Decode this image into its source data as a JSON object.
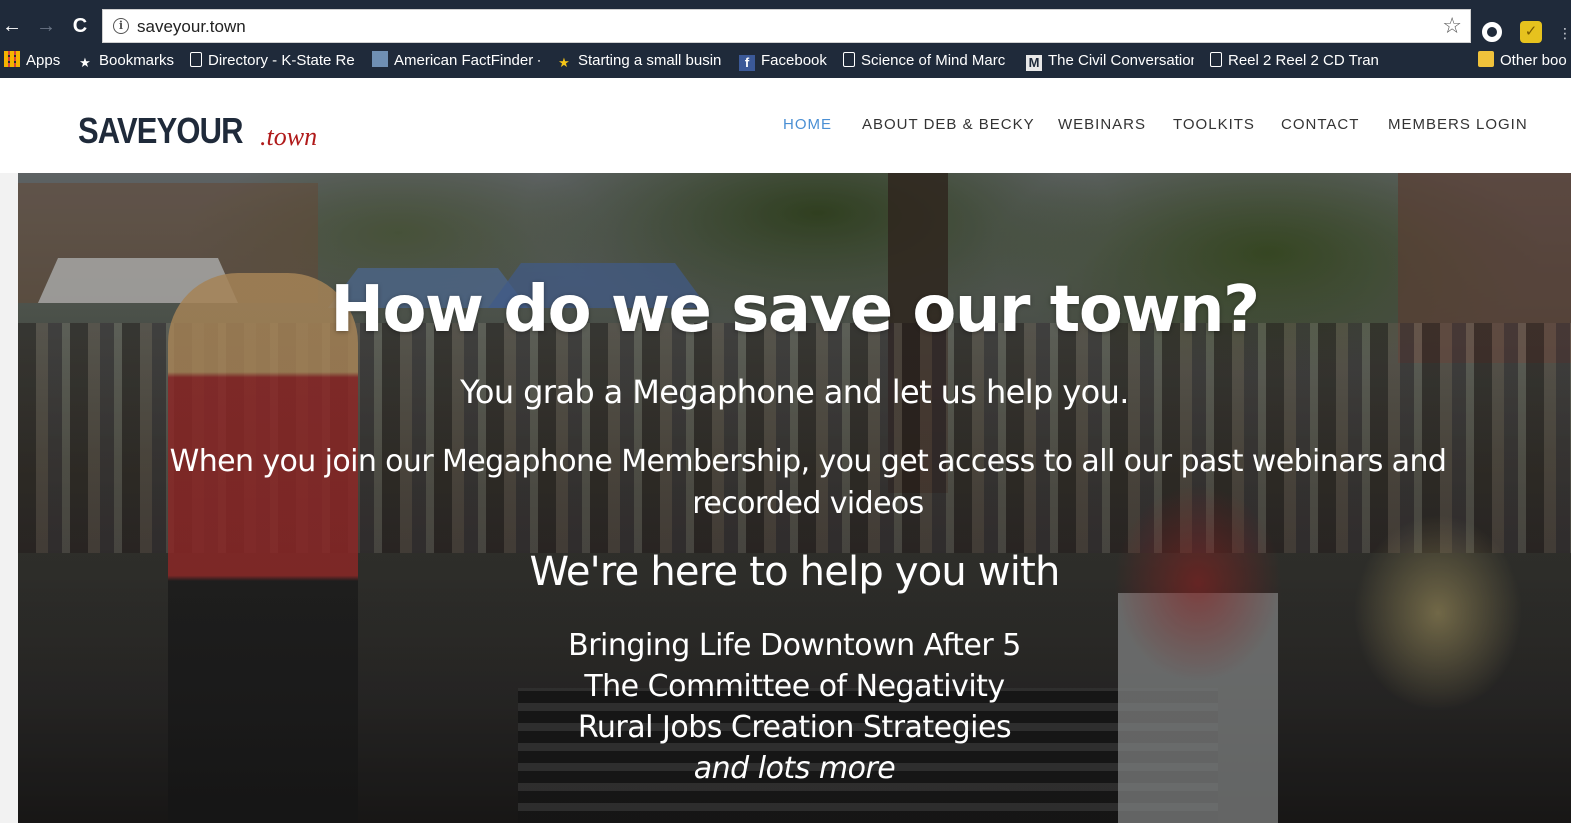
{
  "browser": {
    "url": "saveyour.town",
    "icons": {
      "back": "←",
      "forward": "→",
      "reload": "C",
      "info": "i",
      "star": "☆",
      "check": "✓"
    },
    "bookmarks": [
      {
        "label": "Apps",
        "icon": "apps-icon"
      },
      {
        "label": "Bookmarks",
        "icon": "star-icon"
      },
      {
        "label": "Directory - K-State Re",
        "icon": "page-icon"
      },
      {
        "label": "American FactFinder -",
        "icon": "factfinder-icon"
      },
      {
        "label": "Starting a small busin",
        "icon": "star-icon"
      },
      {
        "label": "Facebook",
        "icon": "facebook-icon"
      },
      {
        "label": "Science of Mind Marc",
        "icon": "page-icon"
      },
      {
        "label": "The Civil Conversation",
        "icon": "civil-conversation-icon"
      },
      {
        "label": "Reel 2 Reel 2 CD Tran",
        "icon": "page-icon"
      },
      {
        "label": "Other boo",
        "icon": "folder-icon"
      }
    ],
    "bookmark_glyphs": {
      "facebook": "f",
      "civil": "M"
    }
  },
  "site": {
    "logo_main": "SAVEYOUR",
    "logo_tld": ".town",
    "nav": [
      {
        "label": "HOME",
        "active": true
      },
      {
        "label": "ABOUT DEB & BECKY",
        "active": false
      },
      {
        "label": "WEBINARS",
        "active": false
      },
      {
        "label": "TOOLKITS",
        "active": false
      },
      {
        "label": "CONTACT",
        "active": false
      },
      {
        "label": "MEMBERS LOGIN",
        "active": false
      }
    ],
    "colors": {
      "nav_active": "#4a8fd4",
      "logo_tld": "#b01a1a",
      "logo_main": "#1f2a3a",
      "chrome": "#1f2a3a"
    }
  },
  "hero": {
    "title": "How do we save our town?",
    "subtitle": "You grab a Megaphone and let us help you.",
    "join_text": "When you join our Megaphone Membership, you get access to all our past webinars and recorded videos",
    "help_heading": "We're here to help you with",
    "list": [
      "Bringing Life Downtown After 5",
      "The Committee of Negativity",
      "Rural Jobs Creation Strategies",
      "and lots more"
    ]
  }
}
